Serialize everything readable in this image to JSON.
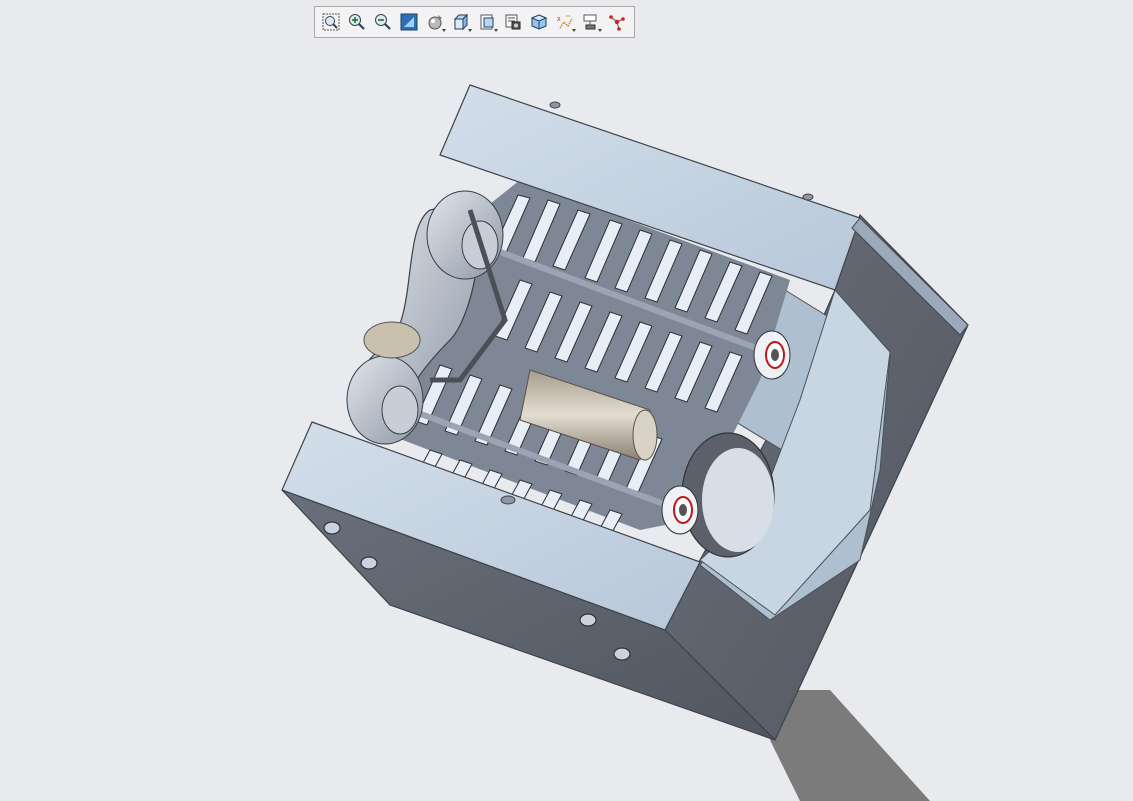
{
  "viewport": {
    "background_color": "#e9eaed",
    "model_name": "",
    "part_color": "#c3d2e2",
    "part_shade_color": "#5d626c"
  },
  "toolbar": {
    "items": [
      {
        "icon": "zoom-window-icon"
      },
      {
        "icon": "zoom-in-icon"
      },
      {
        "icon": "zoom-out-icon"
      },
      {
        "icon": "refit-icon"
      },
      {
        "icon": "display-style-icon",
        "has_dropdown": true
      },
      {
        "icon": "view-orientation-icon",
        "has_dropdown": true
      },
      {
        "icon": "saved-views-icon",
        "has_dropdown": true
      },
      {
        "icon": "view-manager-icon"
      },
      {
        "icon": "perspective-icon"
      },
      {
        "icon": "datum-display-icon",
        "has_dropdown": true
      },
      {
        "icon": "annotation-display-icon",
        "has_dropdown": true
      },
      {
        "icon": "spin-center-icon"
      }
    ]
  }
}
